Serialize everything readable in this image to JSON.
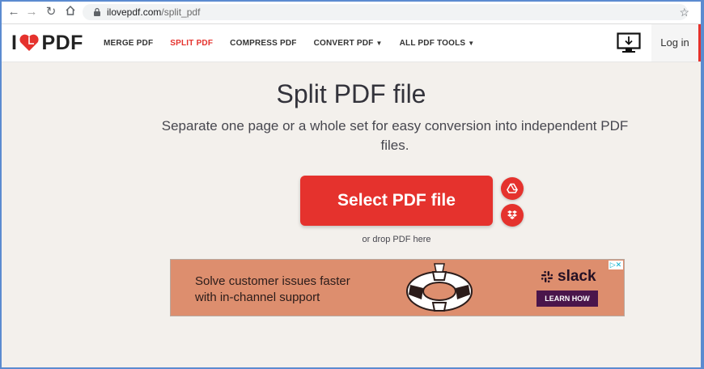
{
  "browser": {
    "url_domain": "ilovepdf.com",
    "url_path": "/split_pdf"
  },
  "header": {
    "logo_left": "I",
    "logo_right": "PDF",
    "menu": [
      {
        "label": "MERGE PDF",
        "active": false
      },
      {
        "label": "SPLIT PDF",
        "active": true
      },
      {
        "label": "COMPRESS PDF",
        "active": false
      },
      {
        "label": "CONVERT PDF",
        "active": false,
        "caret": true
      },
      {
        "label": "ALL PDF TOOLS",
        "active": false,
        "caret": true
      }
    ],
    "login": "Log in"
  },
  "main": {
    "title": "Split PDF file",
    "subtitle": "Separate one page or a whole set for easy conversion into independent PDF files.",
    "select_button": "Select PDF file",
    "drop_hint": "or drop PDF here"
  },
  "ad": {
    "line1": "Solve customer issues faster",
    "line2": "with in-channel support",
    "brand": "slack",
    "cta": "LEARN HOW"
  },
  "colors": {
    "accent": "#e5322d",
    "ad_bg": "#dd8e6e",
    "ad_button": "#4a154b"
  },
  "icons": [
    "back-icon",
    "forward-icon",
    "reload-icon",
    "home-icon",
    "lock-icon",
    "star-icon",
    "heart-icon",
    "desktop-download-icon",
    "google-drive-icon",
    "dropbox-icon",
    "ad-choices-icon"
  ]
}
